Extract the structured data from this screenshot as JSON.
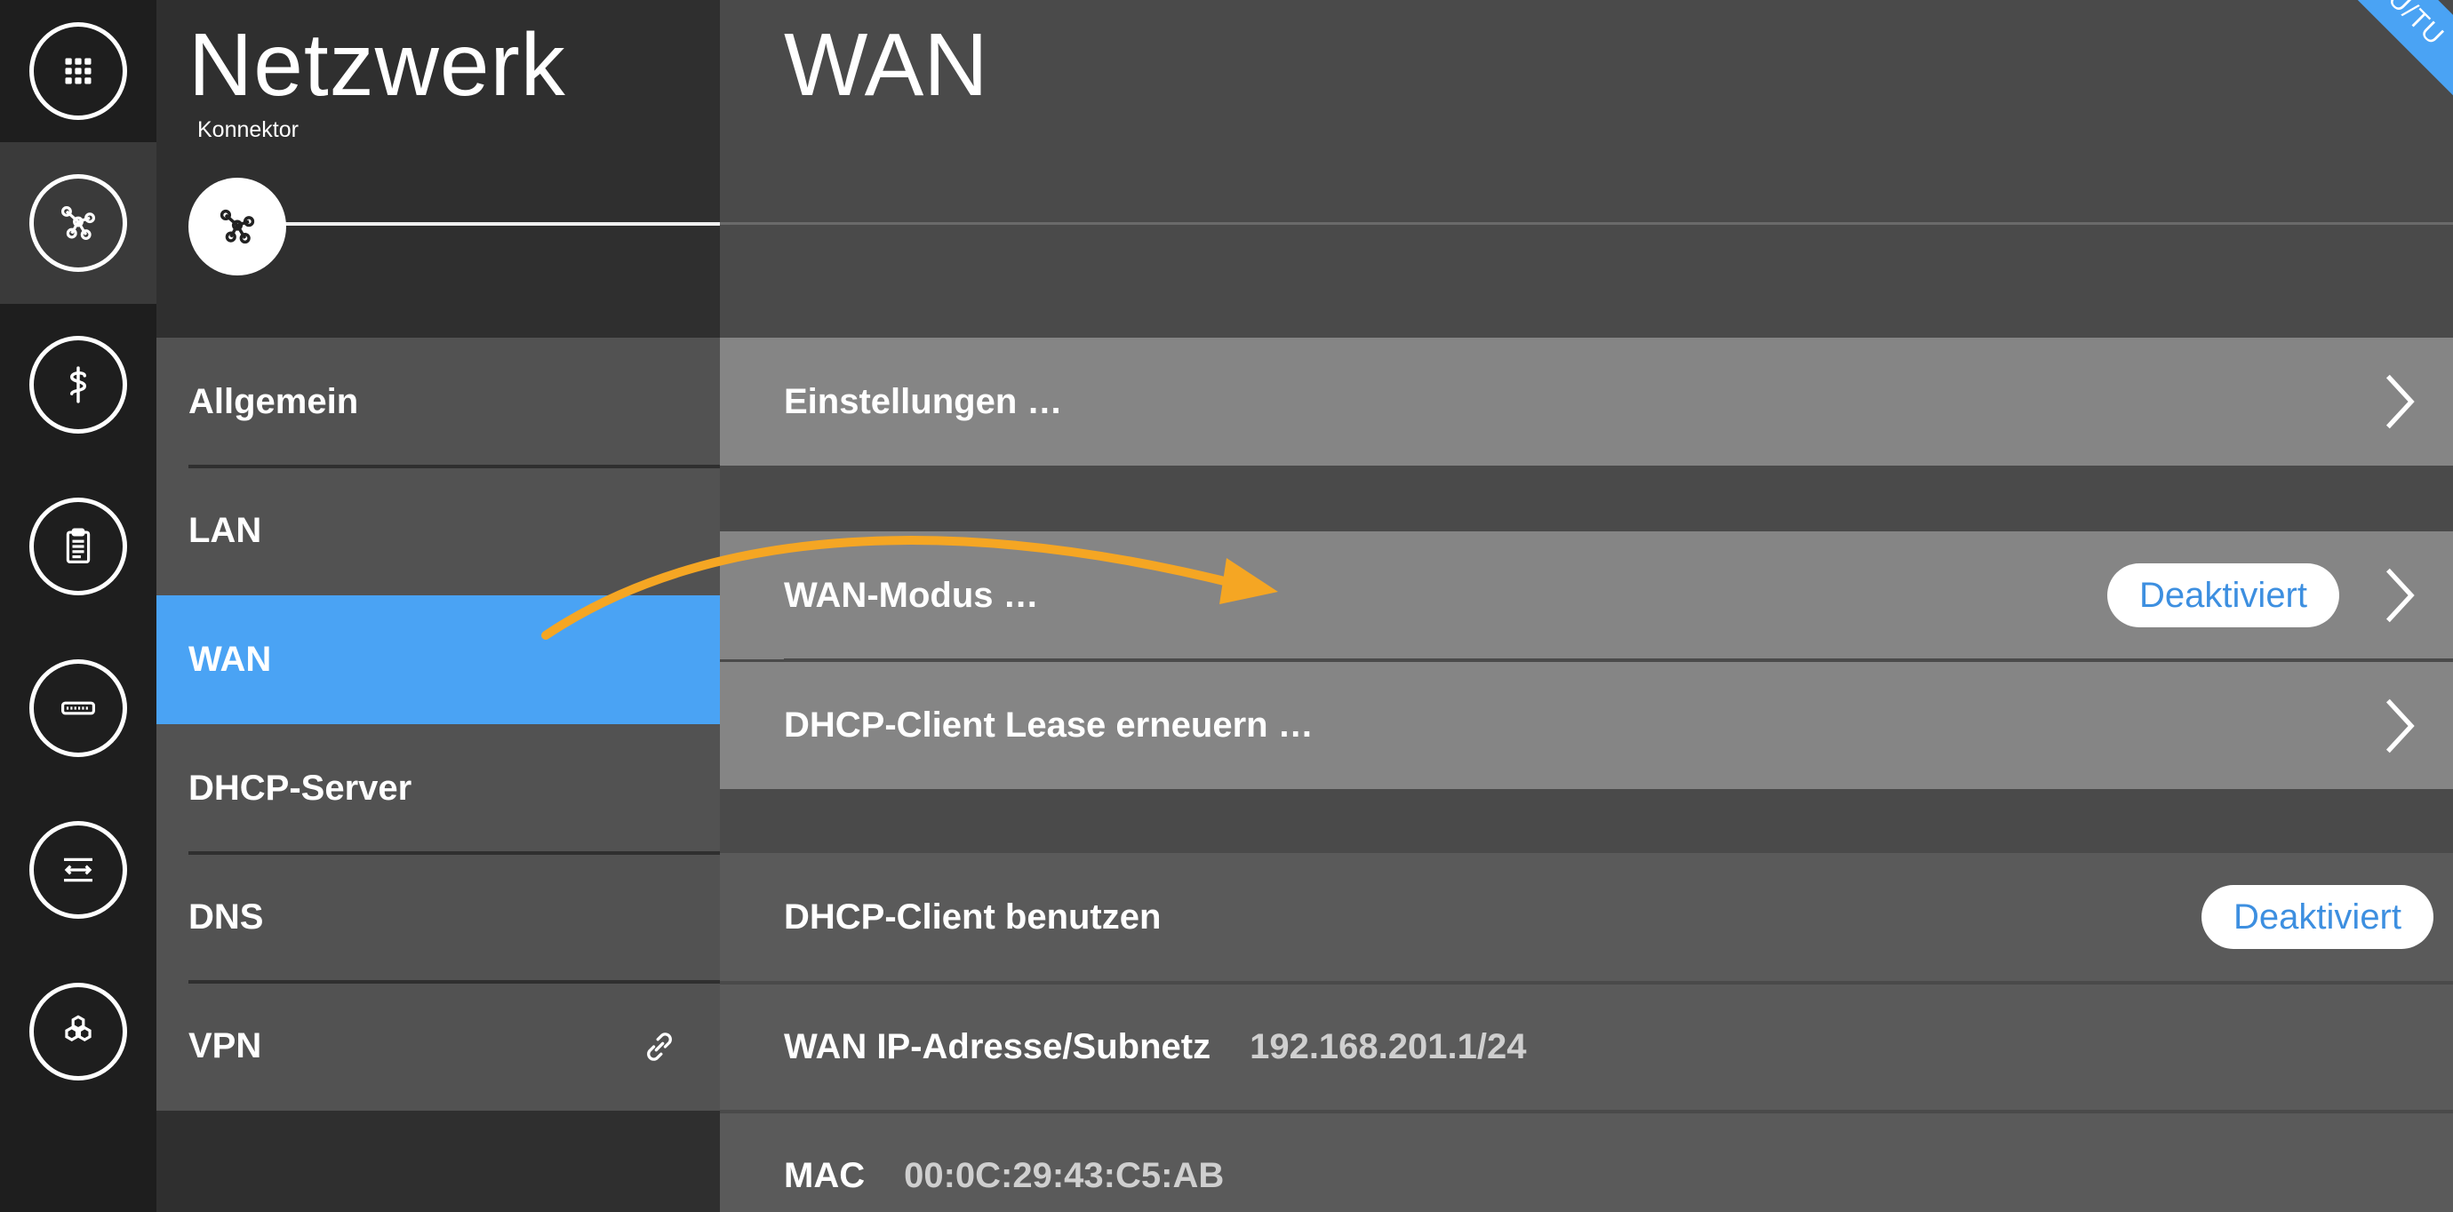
{
  "rail": {
    "items": [
      {
        "icon": "apps-grid-icon",
        "active": false
      },
      {
        "icon": "network-icon",
        "active": true
      },
      {
        "icon": "medical-icon",
        "active": false
      },
      {
        "icon": "clipboard-icon",
        "active": false
      },
      {
        "icon": "card-reader-icon",
        "active": false
      },
      {
        "icon": "transfer-icon",
        "active": false
      },
      {
        "icon": "modules-icon",
        "active": false
      }
    ]
  },
  "sidebar": {
    "title": "Netzwerk",
    "subtitle": "Konnektor",
    "items": [
      {
        "label": "Allgemein"
      },
      {
        "label": "LAN"
      },
      {
        "label": "WAN",
        "active": true
      },
      {
        "label": "DHCP-Server"
      },
      {
        "label": "DNS"
      },
      {
        "label": "VPN",
        "icon": "link-icon"
      }
    ]
  },
  "main": {
    "title": "WAN",
    "corner_badge": "RU/TU",
    "settings_label": "Einstellungen …",
    "wan_mode_label": "WAN-Modus …",
    "wan_mode_status": "Deaktiviert",
    "dhcp_lease_label": "DHCP-Client Lease erneuern …",
    "dhcp_client_label": "DHCP-Client benutzen",
    "dhcp_client_status": "Deaktiviert",
    "wan_ip_label": "WAN IP-Adresse/Subnetz",
    "wan_ip_value": "192.168.201.1/24",
    "mac_label": "MAC",
    "mac_value": "00:0C:29:43:C5:AB"
  },
  "colors": {
    "accent": "#4aa3f4",
    "annotation_arrow": "#f5a623",
    "pill_text": "#3d8fe0"
  }
}
